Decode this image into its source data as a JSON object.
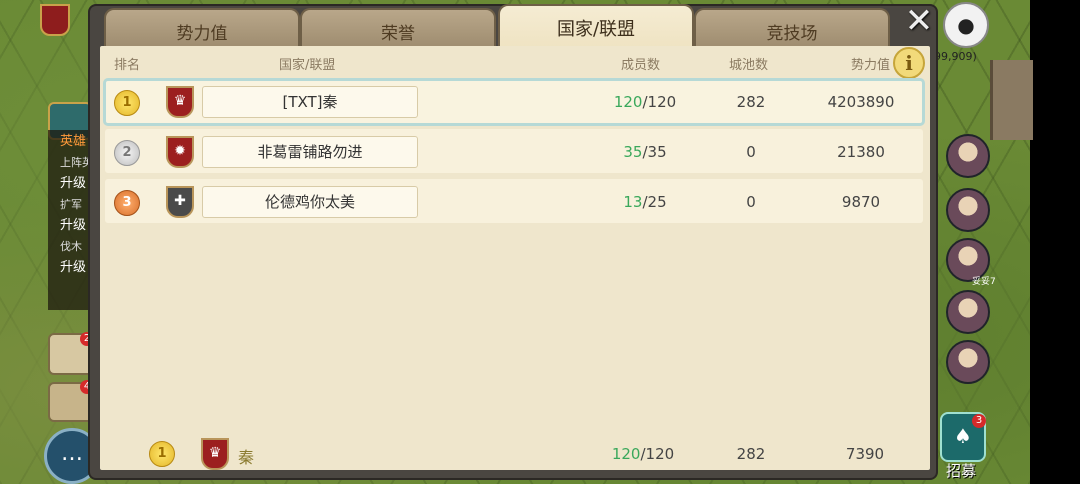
{
  "hud": {
    "coords": "99,909)",
    "quest_title": "英雄",
    "quest_lines": [
      "上阵英",
      "升级",
      "扩军",
      "升级",
      "伐木",
      "升级"
    ],
    "map_badge": "2",
    "sword_badge": "4",
    "recruit_badge": "3",
    "recruit_label": "招募",
    "hero_level": "妥妥7"
  },
  "tabs": [
    {
      "label": "势力值",
      "active": false
    },
    {
      "label": "荣誉",
      "active": false
    },
    {
      "label": "国家/联盟",
      "active": true
    },
    {
      "label": "竞技场",
      "active": false
    }
  ],
  "headers": {
    "rank": "排名",
    "name": "国家/联盟",
    "members": "成员数",
    "cities": "城池数",
    "power": "势力值"
  },
  "rows": [
    {
      "rank": "1",
      "medal": "gold",
      "emblem": "crown-icon",
      "name": "[TXT]秦",
      "members_cur": "120",
      "members_max": "/120",
      "cities": "282",
      "power": "4203890"
    },
    {
      "rank": "2",
      "medal": "silver",
      "emblem": "sun-icon",
      "name": "非葛雷铺路勿进",
      "members_cur": "35",
      "members_max": "/35",
      "cities": "0",
      "power": "21380"
    },
    {
      "rank": "3",
      "medal": "bronze",
      "emblem": "shield-icon",
      "name": "伦德鸡你太美",
      "members_cur": "13",
      "members_max": "/25",
      "cities": "0",
      "power": "9870"
    }
  ],
  "footer": {
    "rank": "1",
    "name": "秦",
    "members_cur": "120",
    "members_max": "/120",
    "cities": "282",
    "power": "7390"
  }
}
